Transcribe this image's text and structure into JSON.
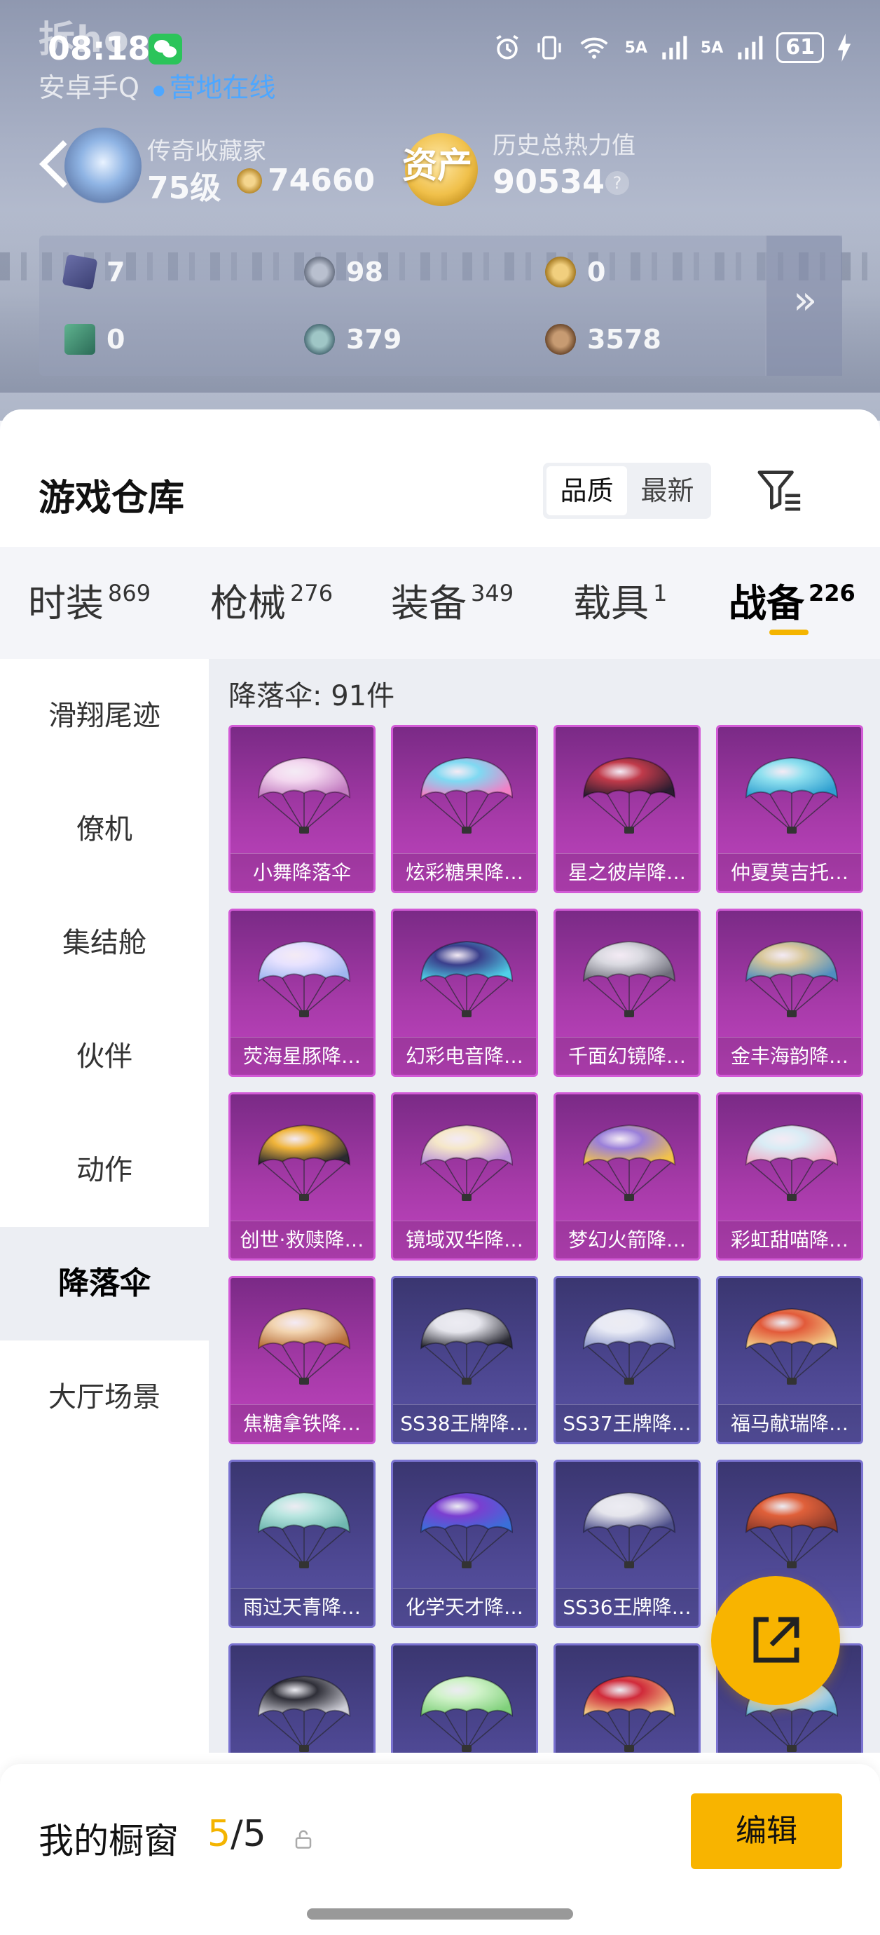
{
  "status_bar": {
    "watermark": "拆ho",
    "time": "08:18",
    "battery": "61",
    "signal_1": "5A",
    "signal_2": "5A",
    "subtitle": "安卓手Q",
    "online": "营地在线"
  },
  "profile": {
    "title": "传奇收藏家",
    "level": "75级",
    "coins": "74660",
    "asset_label": "资产",
    "heat_label": "历史总热力值",
    "heat_value": "90534",
    "help": "?"
  },
  "stats": [
    {
      "icon": "card-icon",
      "value": "7"
    },
    {
      "icon": "silver-coin-icon",
      "value": "98"
    },
    {
      "icon": "gold-coin-icon",
      "value": "0"
    },
    {
      "icon": "green-card-icon",
      "value": "0"
    },
    {
      "icon": "teal-coin-icon",
      "value": "379"
    },
    {
      "icon": "bronze-coin-icon",
      "value": "3578"
    }
  ],
  "warehouse": {
    "title": "游戏仓库",
    "sort_options": [
      "品质",
      "最新"
    ],
    "active_sort": "品质"
  },
  "categories": [
    {
      "label": "时装",
      "count": "869"
    },
    {
      "label": "枪械",
      "count": "276"
    },
    {
      "label": "装备",
      "count": "349"
    },
    {
      "label": "载具",
      "count": "1"
    },
    {
      "label": "战备",
      "count": "226"
    }
  ],
  "active_category": "战备",
  "sidebar": [
    "滑翔尾迹",
    "僚机",
    "集结舱",
    "伙伴",
    "动作",
    "降落伞",
    "大厅场景"
  ],
  "active_sidebar": "降落伞",
  "content": {
    "count_label": "降落伞: 91件"
  },
  "items": [
    {
      "name": "小舞降落伞",
      "tier": "purple",
      "art": [
        "#f3d7ef",
        "#c27bc0"
      ]
    },
    {
      "name": "炫彩糖果降…",
      "tier": "purple",
      "art": [
        "#7fd9f2",
        "#f27fc6"
      ]
    },
    {
      "name": "星之彼岸降…",
      "tier": "purple",
      "art": [
        "#c03a4a",
        "#2a1c30"
      ]
    },
    {
      "name": "仲夏莫吉托…",
      "tier": "purple",
      "art": [
        "#8fe0ef",
        "#2f9fd0"
      ]
    },
    {
      "name": "荧海星豚降…",
      "tier": "purple",
      "art": [
        "#e7e2ff",
        "#9fb6f0"
      ]
    },
    {
      "name": "幻彩电音降…",
      "tier": "purple",
      "art": [
        "#3a3f8c",
        "#4fd0e8"
      ]
    },
    {
      "name": "千面幻镜降…",
      "tier": "purple",
      "art": [
        "#d9d9e0",
        "#6e6e7a"
      ]
    },
    {
      "name": "金丰海韵降…",
      "tier": "purple",
      "art": [
        "#d8c79a",
        "#4f8ec0"
      ]
    },
    {
      "name": "创世·救赎降…",
      "tier": "purple",
      "art": [
        "#f0b43a",
        "#2a2a30"
      ]
    },
    {
      "name": "镜域双华降…",
      "tier": "purple",
      "art": [
        "#f5e7c8",
        "#b98fd9"
      ]
    },
    {
      "name": "梦幻火箭降…",
      "tier": "purple",
      "art": [
        "#9a7fd9",
        "#f2c24a"
      ]
    },
    {
      "name": "彩虹甜喵降…",
      "tier": "purple",
      "art": [
        "#d9ecf5",
        "#f2a9c6"
      ]
    },
    {
      "name": "焦糖拿铁降…",
      "tier": "purple",
      "art": [
        "#f2d4b0",
        "#b86e3a"
      ]
    },
    {
      "name": "SS38王牌降…",
      "tier": "blue",
      "art": [
        "#e5e5ec",
        "#2a2a34"
      ]
    },
    {
      "name": "SS37王牌降…",
      "tier": "blue",
      "art": [
        "#e8eaf5",
        "#8b95c9"
      ]
    },
    {
      "name": "福马献瑞降…",
      "tier": "blue",
      "art": [
        "#e25a3a",
        "#f2d08a"
      ]
    },
    {
      "name": "雨过天青降…",
      "tier": "blue",
      "art": [
        "#b9e6e0",
        "#6fb7b0"
      ]
    },
    {
      "name": "化学天才降…",
      "tier": "blue",
      "art": [
        "#7a3fd0",
        "#3a6fd9"
      ]
    },
    {
      "name": "SS36王牌降…",
      "tier": "blue",
      "art": [
        "#e5e5ec",
        "#4d4f8a"
      ]
    },
    {
      "name": "",
      "tier": "blue",
      "art": [
        "#e0603a",
        "#8a3a2a"
      ]
    },
    {
      "name": "",
      "tier": "blue",
      "art": [
        "#2f2f38",
        "#cfcfd8"
      ]
    },
    {
      "name": "",
      "tier": "blue",
      "art": [
        "#cff2c8",
        "#7fd07a"
      ]
    },
    {
      "name": "",
      "tier": "blue",
      "art": [
        "#d02a3a",
        "#f2d08a"
      ]
    },
    {
      "name": "",
      "tier": "blue",
      "art": [
        "#e8eef5",
        "#6fb7d9"
      ]
    }
  ],
  "showcase": {
    "label": "我的橱窗",
    "current": "5",
    "total": "/5",
    "edit": "编辑"
  }
}
